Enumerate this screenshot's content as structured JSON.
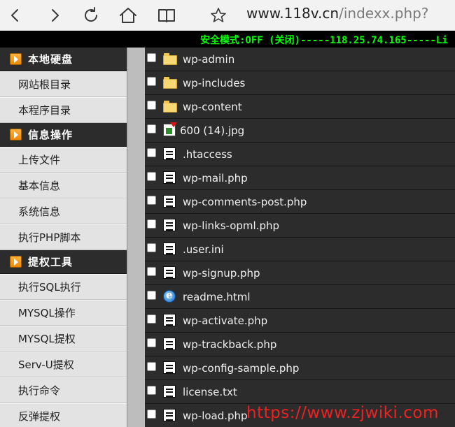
{
  "browser": {
    "url_host": "www.118v.cn",
    "url_path": "/indexx.php?"
  },
  "status": {
    "text": "安全模式:OFF (关闭)-----118.25.74.165-----Li"
  },
  "sidebar": {
    "sections": [
      {
        "title": "本地硬盘",
        "items": [
          "网站根目录",
          "本程序目录"
        ]
      },
      {
        "title": "信息操作",
        "items": [
          "上传文件",
          "基本信息",
          "系统信息",
          "执行PHP脚本"
        ]
      },
      {
        "title": "提权工具",
        "items": [
          "执行SQL执行",
          "MYSQL操作",
          "MYSQL提权",
          "Serv-U提权",
          "执行命令",
          "反弹提权"
        ]
      }
    ]
  },
  "files": [
    {
      "name": "wp-admin",
      "icon": "folder-icon"
    },
    {
      "name": "wp-includes",
      "icon": "folder-icon"
    },
    {
      "name": "wp-content",
      "icon": "folder-icon"
    },
    {
      "name": "600 (14).jpg",
      "icon": "image-file-icon"
    },
    {
      "name": ".htaccess",
      "icon": "text-file-icon"
    },
    {
      "name": "wp-mail.php",
      "icon": "text-file-icon"
    },
    {
      "name": "wp-comments-post.php",
      "icon": "text-file-icon"
    },
    {
      "name": "wp-links-opml.php",
      "icon": "text-file-icon"
    },
    {
      "name": ".user.ini",
      "icon": "text-file-icon"
    },
    {
      "name": "wp-signup.php",
      "icon": "text-file-icon"
    },
    {
      "name": "readme.html",
      "icon": "html-file-icon"
    },
    {
      "name": "wp-activate.php",
      "icon": "text-file-icon"
    },
    {
      "name": "wp-trackback.php",
      "icon": "text-file-icon"
    },
    {
      "name": "wp-config-sample.php",
      "icon": "text-file-icon"
    },
    {
      "name": "license.txt",
      "icon": "text-file-icon"
    },
    {
      "name": "wp-load.php",
      "icon": "text-file-icon"
    }
  ],
  "watermark": "https://www.zjwiki.com",
  "colors": {
    "status_text": "#00ff00",
    "sidebar_header_bg": "#2c2c2c",
    "file_list_bg": "#2c2c2c",
    "watermark": "#ee2222"
  }
}
